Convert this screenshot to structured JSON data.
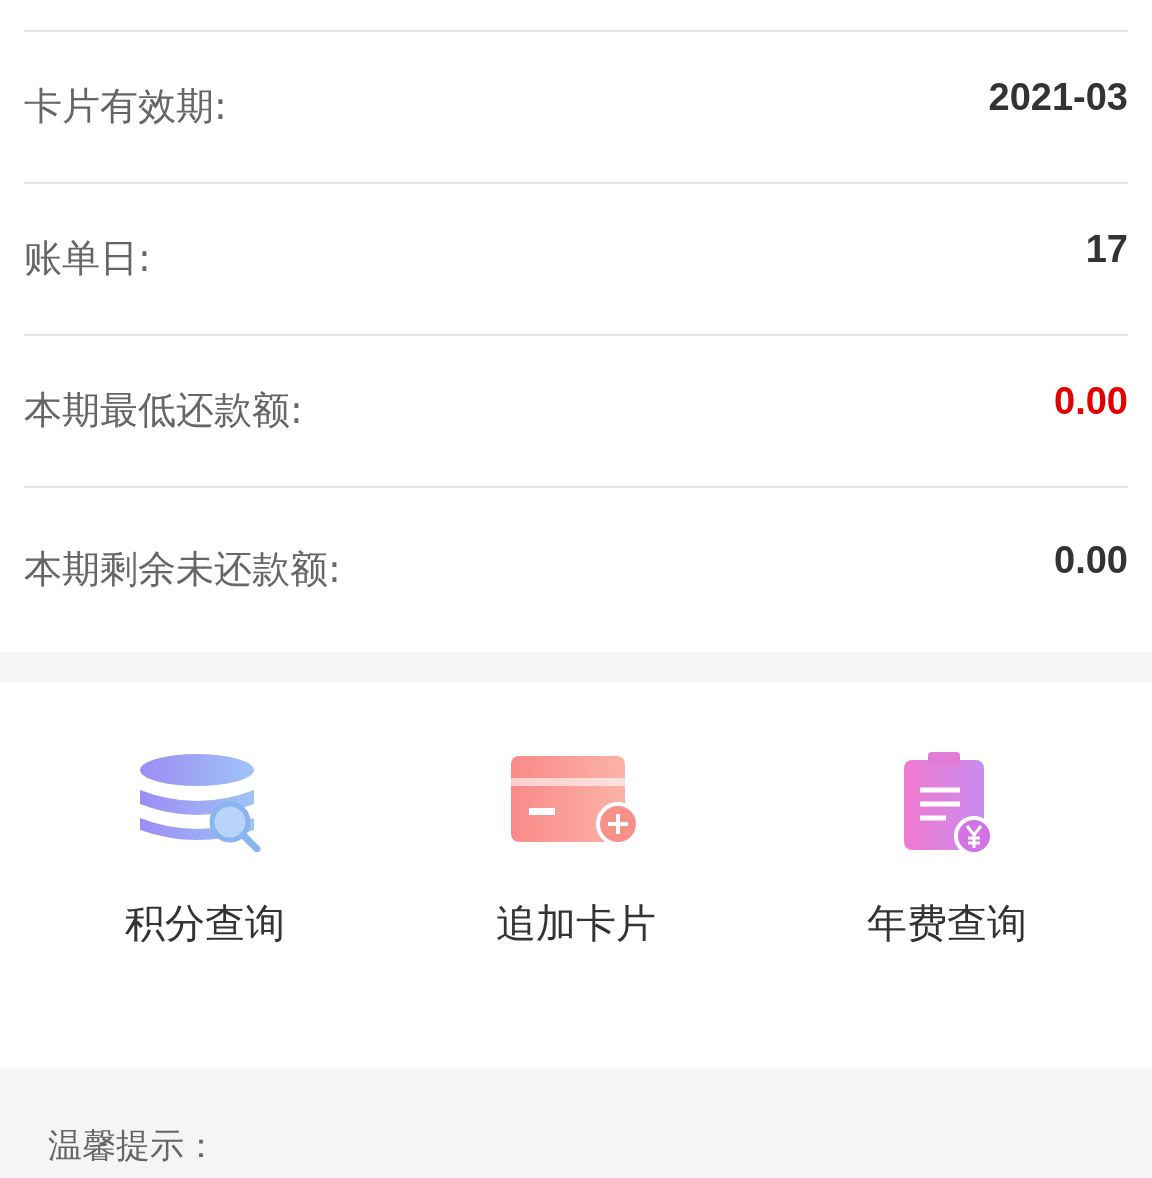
{
  "details": [
    {
      "label": "卡片有效期:",
      "value": "2021-03",
      "kind": "normal"
    },
    {
      "label": "账单日:",
      "value": "17",
      "kind": "normal"
    },
    {
      "label": "本期最低还款额:",
      "value": "0.00",
      "kind": "alert"
    },
    {
      "label": "本期剩余未还款额:",
      "value": "0.00",
      "kind": "normal"
    }
  ],
  "shortcuts": [
    {
      "label": "积分查询",
      "kind": "points"
    },
    {
      "label": "追加卡片",
      "kind": "add-card"
    },
    {
      "label": "年费查询",
      "kind": "annual-fee"
    }
  ],
  "tips": {
    "title": "温馨提示："
  }
}
